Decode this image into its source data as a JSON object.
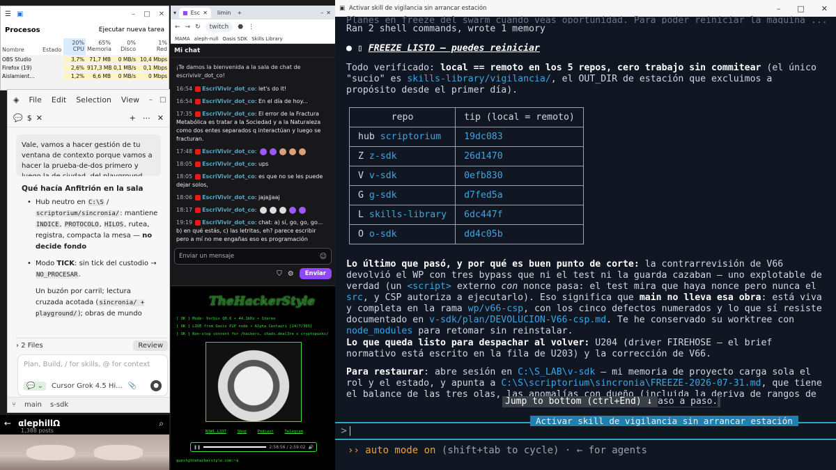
{
  "taskmgr": {
    "header": "Procesos",
    "run_task": "Ejecutar nueva tarea",
    "cols": {
      "name": "Nombre",
      "state": "Estado",
      "cpu_pct": "20%",
      "cpu": "CPU",
      "mem_pct": "65%",
      "mem": "Memoria",
      "disk_pct": "0%",
      "disk": "Disco",
      "net_pct": "1%",
      "net": "Red"
    },
    "rows": [
      {
        "name": "OBS Studio",
        "state": "",
        "cpu": "3,7%",
        "mem": "71,7 MB",
        "disk": "0 MB/s",
        "net": "10,4 Mbps"
      },
      {
        "name": "Firefox (19)",
        "state": "",
        "cpu": "2,6%",
        "mem": "917,3 MB",
        "disk": "0,1 MB/s",
        "net": "0,1 Mbps"
      },
      {
        "name": "Aislamient...",
        "state": "",
        "cpu": "1,2%",
        "mem": "6,6 MB",
        "disk": "0 MB/s",
        "net": "0 Mbps"
      }
    ]
  },
  "cursor": {
    "menu": [
      "File",
      "Edit",
      "Selection",
      "View"
    ],
    "tab_label": "$",
    "bubble": "Vale, vamos a hacer gestión de tu ventana de contexto porque vamos a hacer la prueba-de-dos primero y luego la de ciudad, del playground",
    "section": "Qué hacía Anfitrión en la sala",
    "b1_pre": "Hub neutro en ",
    "b1_code1": "C:\\S",
    "b1_mid": " / ",
    "b1_code2": "scriptorium/sincronia/",
    "b1_post": ": mantiene ",
    "b1_c3": "INDICE",
    "b1_c4": "PROTOCOLO",
    "b1_c5": "HILOS",
    "b1_tail": ", rutea, registra, compacta la mesa — ",
    "b1_bold": "no decide fondo",
    "b2_pre": "Modo ",
    "b2_bold": "TICK",
    "b2_mid": ": sin tick del custodio → ",
    "b2_code": "NO_PROCESAR",
    "b3_pre": "Un buzón por carril; lectura cruzada acotada (",
    "b3_code": "sincronia/ + playground/",
    "b3_mid": "); obras de mundo ",
    "b3_bold": "opacas",
    "b3_post": " salvo",
    "files": "2 Files",
    "review": "Review",
    "placeholder": "Plan, Build, / for skills, @ for context",
    "model": "Cursor Grok 4.5 Hi...",
    "branch": "main",
    "repo": "s-sdk"
  },
  "twitter": {
    "name": "αlephillΩ",
    "posts": "1,388 posts"
  },
  "chrome": {
    "tabs": [
      "Esc",
      "limin"
    ],
    "url": "twitch",
    "bookmarks": [
      "MAMA",
      "aleph-null",
      "Oasis SDK",
      "Skills Library"
    ],
    "chat_header": "Mi chat",
    "welcome": "¡Te damos la bienvenida a la sala de chat de escrivivir_dot_co!",
    "user": "EscriVivir_dot_co",
    "messages": [
      {
        "t": "16:54",
        "text": "let's do it!"
      },
      {
        "t": "16:54",
        "text": "En el día de hoy..."
      },
      {
        "t": "17:35",
        "text": "El error de la Fractura Metabólica es tratar a la Sociedad y a la Naturaleza como dos entes separados q interactúan y luego se fracturan."
      },
      {
        "t": "17:48",
        "text": ""
      },
      {
        "t": "18:05",
        "text": "ups"
      },
      {
        "t": "18:05",
        "text": "es que no se les puede dejar solos,"
      },
      {
        "t": "18:06",
        "text": "jajajjaaj"
      },
      {
        "t": "18:17",
        "text": ""
      },
      {
        "t": "19:19",
        "text": "chat: a) sí, go, go, go... b) en qué estás, c) las letritas, eh? parece escribir pero a mí no me engañas eso es programación"
      }
    ],
    "input_placeholder": "Enviar un mensaje",
    "send": "Enviar",
    "stream_title": "TheHackerStyle",
    "line1": "[ OK ] Mode: Vorbis Q0.6 • 44.1kHz • Stereo",
    "line2": "[ OK ] LIVE from Oasis P2P node • Alpha Centauri [24/7/365]",
    "line3": "[ OK ] Non-stop content for /hackers, chads.deal3re x cryptopunks/",
    "links": [
      "N3W1.L33T",
      "Shop",
      "Podcast",
      "Telegram"
    ],
    "time": "2:58:56 / 2:59:02",
    "mail": "guest@thehackerstyle.com:~$"
  },
  "terminal": {
    "title": "Activar skill de vigilancia sin arrancar estación",
    "l0": "Planes en freeze del swarm cuando veas oportunidad. Para poder reiniciar la maquina ...",
    "l1": "Ran 2 shell commands, wrote 1 memory",
    "heading": "FREEZE LISTO — puedes reiniciar",
    "p1_a": "Todo verificado: ",
    "p1_b": "local == remoto en los 5 repos, cero trabajo sin commitear",
    "p1_c": " (el único \"sucio\" es ",
    "p1_d": "skills-library/vigilancia/",
    "p1_e": ", el OUT_DIR de estación que excluimos a propósito desde el primer día).",
    "table_head": [
      "repo",
      "tip (local = remoto)"
    ],
    "table": [
      [
        "hub",
        "scriptorium",
        "19dc083"
      ],
      [
        "Z",
        "z-sdk",
        "26d1470"
      ],
      [
        "V",
        "v-sdk",
        "0efb830"
      ],
      [
        "G",
        "g-sdk",
        "d7fed5a"
      ],
      [
        "L",
        "skills-library",
        "6dc447f"
      ],
      [
        "O",
        "o-sdk",
        "dd4c05b"
      ]
    ],
    "p2_b": "Lo último que pasó, y por qué es buen punto de corte:",
    "p2_c": " la contrarrevisión de V66 devolvió el WP con tres bypass que ni el test ni la guarda cazaban — uno explotable de verdad (un ",
    "p2_d": "<script>",
    "p2_e": " externo ",
    "p2_f": "con",
    "p2_g": " nonce pasa: el test mira que haya nonce pero nunca el ",
    "p2_h": "src",
    "p2_i": ", y CSP autoriza a ejecutarlo). Eso significa que ",
    "p2_j": "main",
    "p2_k": " no lleva esa obra",
    "p2_l": ": está viva y completa en la rama ",
    "p2_m": "wp/v66-csp",
    "p2_n": ", con los cinco defectos numerados y lo que sí resiste documentado en ",
    "p2_o": "v-sdk/plan/DEVOLUCION-V66-csp.md",
    "p2_p": ". Te he conservado su worktree con ",
    "p2_q": "node_modules",
    "p2_r": " para retomar sin reinstalar.",
    "p3_b": "Lo que queda listo para despachar al volver:",
    "p3_c": " U204 (driver FIREHOSE — el brief normativo está escrito en la fila de U203) y la corrección de V66.",
    "p4_b": "Para restaurar",
    "p4_c": ": abre sesión en ",
    "p4_d": "C:\\S_LAB\\v-sdk",
    "p4_e": " — mi memoria de proyecto carga sola el rol y el estado, y apunta a ",
    "p4_f": "C:\\S\\scriptorium\\sincronia\\FREEZE-2026-07-31.md",
    "p4_g": ", que tiene el balance de las tres olas, las anomalías con dueño (incluida la deriva de rangos de G que rompería una instalaci",
    "p4_h": "aso a paso.",
    "jump": "Jump to bottom (ctrl+End) ↓",
    "skill": "Activar skill de vigilancia sin arrancar estación",
    "auto_a": "›› auto mode on",
    "auto_b": " (shift+tab to cycle) · ← for agents"
  }
}
